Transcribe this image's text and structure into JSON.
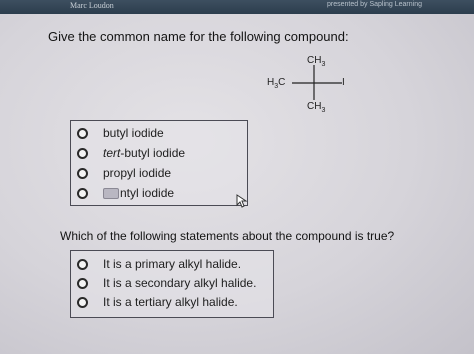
{
  "header": {
    "left_text": "Marc Loudon",
    "right_text": "presented by Sapling Learning"
  },
  "question1": {
    "prompt": "Give the common name for the following compound:",
    "structure": {
      "top_group": "CH3",
      "left_group": "H3C",
      "right_group": "I",
      "bottom_group": "CH3"
    },
    "options": [
      {
        "prefix": "",
        "italic_part": "",
        "text": "butyl iodide"
      },
      {
        "prefix": "",
        "italic_part": "tert",
        "text": "-butyl iodide"
      },
      {
        "prefix": "",
        "italic_part": "",
        "text": "propyl iodide"
      },
      {
        "prefix": "chip",
        "italic_part": "",
        "text": "ntyl iodide"
      }
    ]
  },
  "question2": {
    "prompt": "Which of the following statements about the compound is true?",
    "options": [
      {
        "text": "It is a primary alkyl halide."
      },
      {
        "text": "It is a secondary alkyl halide."
      },
      {
        "text": "It is a tertiary alkyl halide."
      }
    ]
  }
}
